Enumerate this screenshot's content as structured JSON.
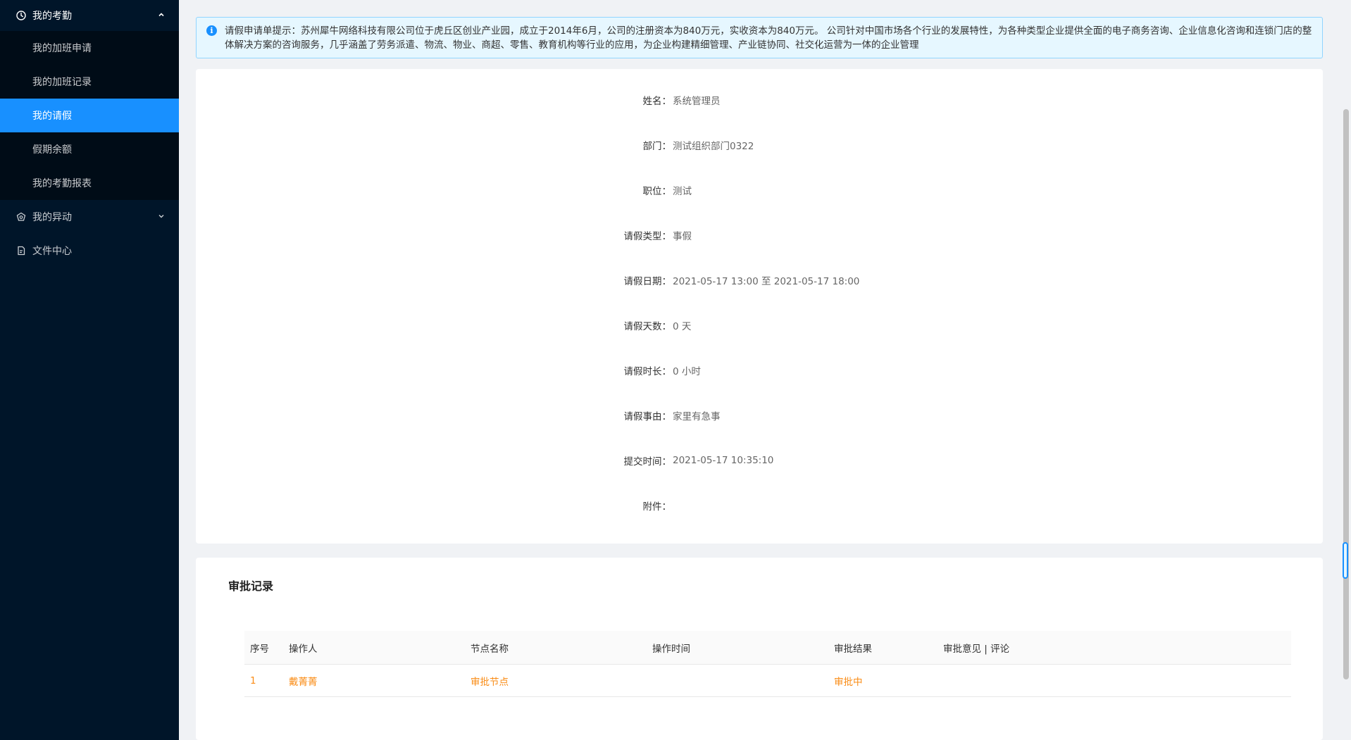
{
  "sidebar": {
    "group": {
      "label": "我的考勤",
      "icon": "clock-icon",
      "expanded": true
    },
    "subitems": [
      {
        "label": "我的加班申请",
        "active": false
      },
      {
        "label": "我的加班记录",
        "active": false
      },
      {
        "label": "我的请假",
        "active": true
      },
      {
        "label": "假期余额",
        "active": false
      },
      {
        "label": "我的考勤报表",
        "active": false
      }
    ],
    "items": [
      {
        "label": "我的异动",
        "icon": "hexagon-icon",
        "has_children": true
      },
      {
        "label": "文件中心",
        "icon": "document-icon",
        "has_children": false
      }
    ]
  },
  "alert": {
    "text": "请假申请单提示：苏州犀牛网络科技有限公司位于虎丘区创业产业园，成立于2014年6月，公司的注册资本为840万元，实收资本为840万元。 公司针对中国市场各个行业的发展特性，为各种类型企业提供全面的电子商务咨询、企业信息化咨询和连锁门店的整体解决方案的咨询服务，几乎涵盖了劳务派遣、物流、物业、商超、零售、教育机构等行业的应用，为企业构建精细管理、产业链协同、社交化运营为一体的企业管理"
  },
  "detail": {
    "fields": [
      {
        "label": "姓名：",
        "value": "系统管理员"
      },
      {
        "label": "部门：",
        "value": "测试组织部门0322"
      },
      {
        "label": "职位：",
        "value": "测试"
      },
      {
        "label": "请假类型：",
        "value": "事假"
      },
      {
        "label": "请假日期：",
        "value": "2021-05-17 13:00 至 2021-05-17 18:00"
      },
      {
        "label": "请假天数：",
        "value": "0 天"
      },
      {
        "label": "请假时长：",
        "value": "0 小时"
      },
      {
        "label": "请假事由：",
        "value": "家里有急事"
      },
      {
        "label": "提交时间：",
        "value": "2021-05-17 10:35:10"
      },
      {
        "label": "附件：",
        "value": ""
      }
    ]
  },
  "approval": {
    "title": "审批记录",
    "columns": [
      "序号",
      "操作人",
      "节点名称",
      "操作时间",
      "审批结果",
      "审批意见 | 评论"
    ],
    "rows": [
      {
        "index": "1",
        "operator": "戴菁菁",
        "node": "审批节点",
        "time": "",
        "result": "审批中",
        "comment": ""
      }
    ],
    "row_color": "#fa8c16"
  }
}
